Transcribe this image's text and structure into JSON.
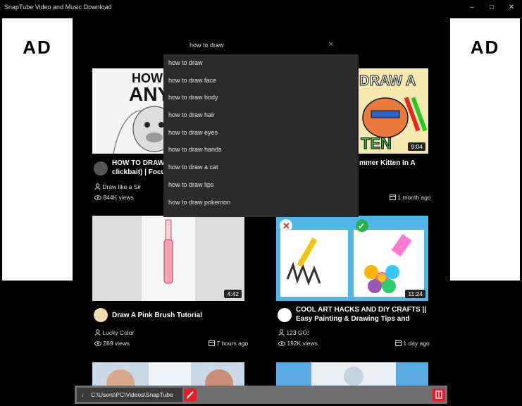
{
  "app": {
    "title": "SnapTube Video and Music Download"
  },
  "ads": {
    "left": "AD",
    "right": "AD"
  },
  "search": {
    "value": "how to draw"
  },
  "suggestions": [
    "how to draw",
    "how to draw face",
    "how to draw body",
    "how to draw hair",
    "how to draw eyes",
    "how to draw hands",
    "how to draw a cat",
    "how to draw lips",
    "how to draw pokemon"
  ],
  "videos": [
    {
      "title": "HOW TO DRAW",
      "title_line2": "clickbait) | Focused",
      "channel": "Draw like a Sir",
      "views": "844K views",
      "age": "",
      "duration": "",
      "thumb_text": "HOW TO ANYT"
    },
    {
      "title": "mmer Kitten In A",
      "channel": "",
      "views": "",
      "age": "1 month ago",
      "duration": "9:04",
      "thumb_text": "DRAW A",
      "thumb_text2": "TEN"
    },
    {
      "title": "Draw A Pink Brush Tutorial",
      "channel": "Lucky Color",
      "views": "289 views",
      "age": "7 hours ago",
      "duration": "4:42"
    },
    {
      "title": "COOL ART HACKS AND DIY CRAFTS ||",
      "title_line2": "Easy Painting & Drawing Tips and",
      "channel": "123 GO!",
      "views": "192K views",
      "age": "1 day ago",
      "duration": "11:24"
    }
  ],
  "bottom": {
    "path": "C:\\Users\\PC\\Videos\\SnapTube"
  },
  "colors": {
    "accent": "#e81c2d",
    "dropdown_bg": "#2b2b2b",
    "background": "#000000"
  }
}
